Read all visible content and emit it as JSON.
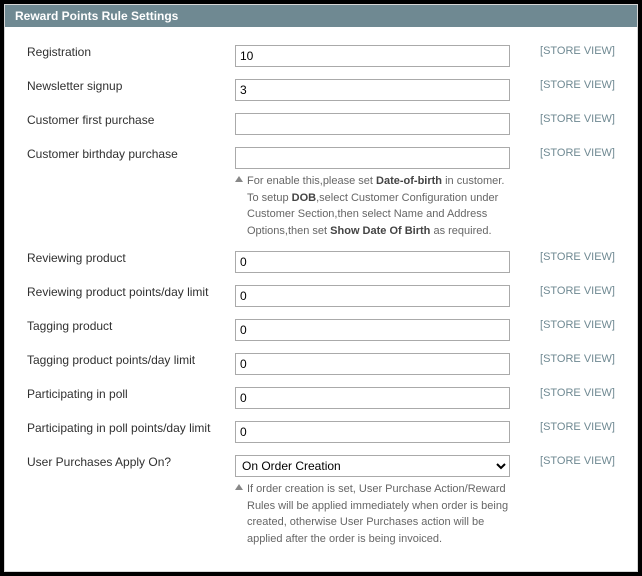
{
  "panel": {
    "title": "Reward Points Rule Settings"
  },
  "scope": "[STORE VIEW]",
  "notes": {
    "birthday": {
      "p1a": "For enable this,please set ",
      "p1b": "Date-of-birth",
      "p1c": " in customer.",
      "p2a": "To setup ",
      "p2b": "DOB",
      "p2c": ",select Customer Configuration under Customer Section,then select Name and Address Options,then set ",
      "p2d": "Show Date Of Birth",
      "p2e": " as required."
    },
    "purchases": "If order creation is set, User Purchase Action/Reward Rules will be applied immediately when order is being created, otherwise User Purchases action will be applied after the order is being invoiced."
  },
  "fields": {
    "registration": {
      "label": "Registration",
      "value": "10"
    },
    "newsletter": {
      "label": "Newsletter signup",
      "value": "3"
    },
    "first_purchase": {
      "label": "Customer first purchase",
      "value": ""
    },
    "birthday_purchase": {
      "label": "Customer birthday purchase",
      "value": ""
    },
    "review": {
      "label": "Reviewing product",
      "value": "0"
    },
    "review_limit": {
      "label": "Reviewing product points/day limit",
      "value": "0"
    },
    "tag": {
      "label": "Tagging product",
      "value": "0"
    },
    "tag_limit": {
      "label": "Tagging product points/day limit",
      "value": "0"
    },
    "poll": {
      "label": "Participating in poll",
      "value": "0"
    },
    "poll_limit": {
      "label": "Participating in poll points/day limit",
      "value": "0"
    },
    "apply_on": {
      "label": "User Purchases Apply On?",
      "value": "On Order Creation"
    }
  }
}
